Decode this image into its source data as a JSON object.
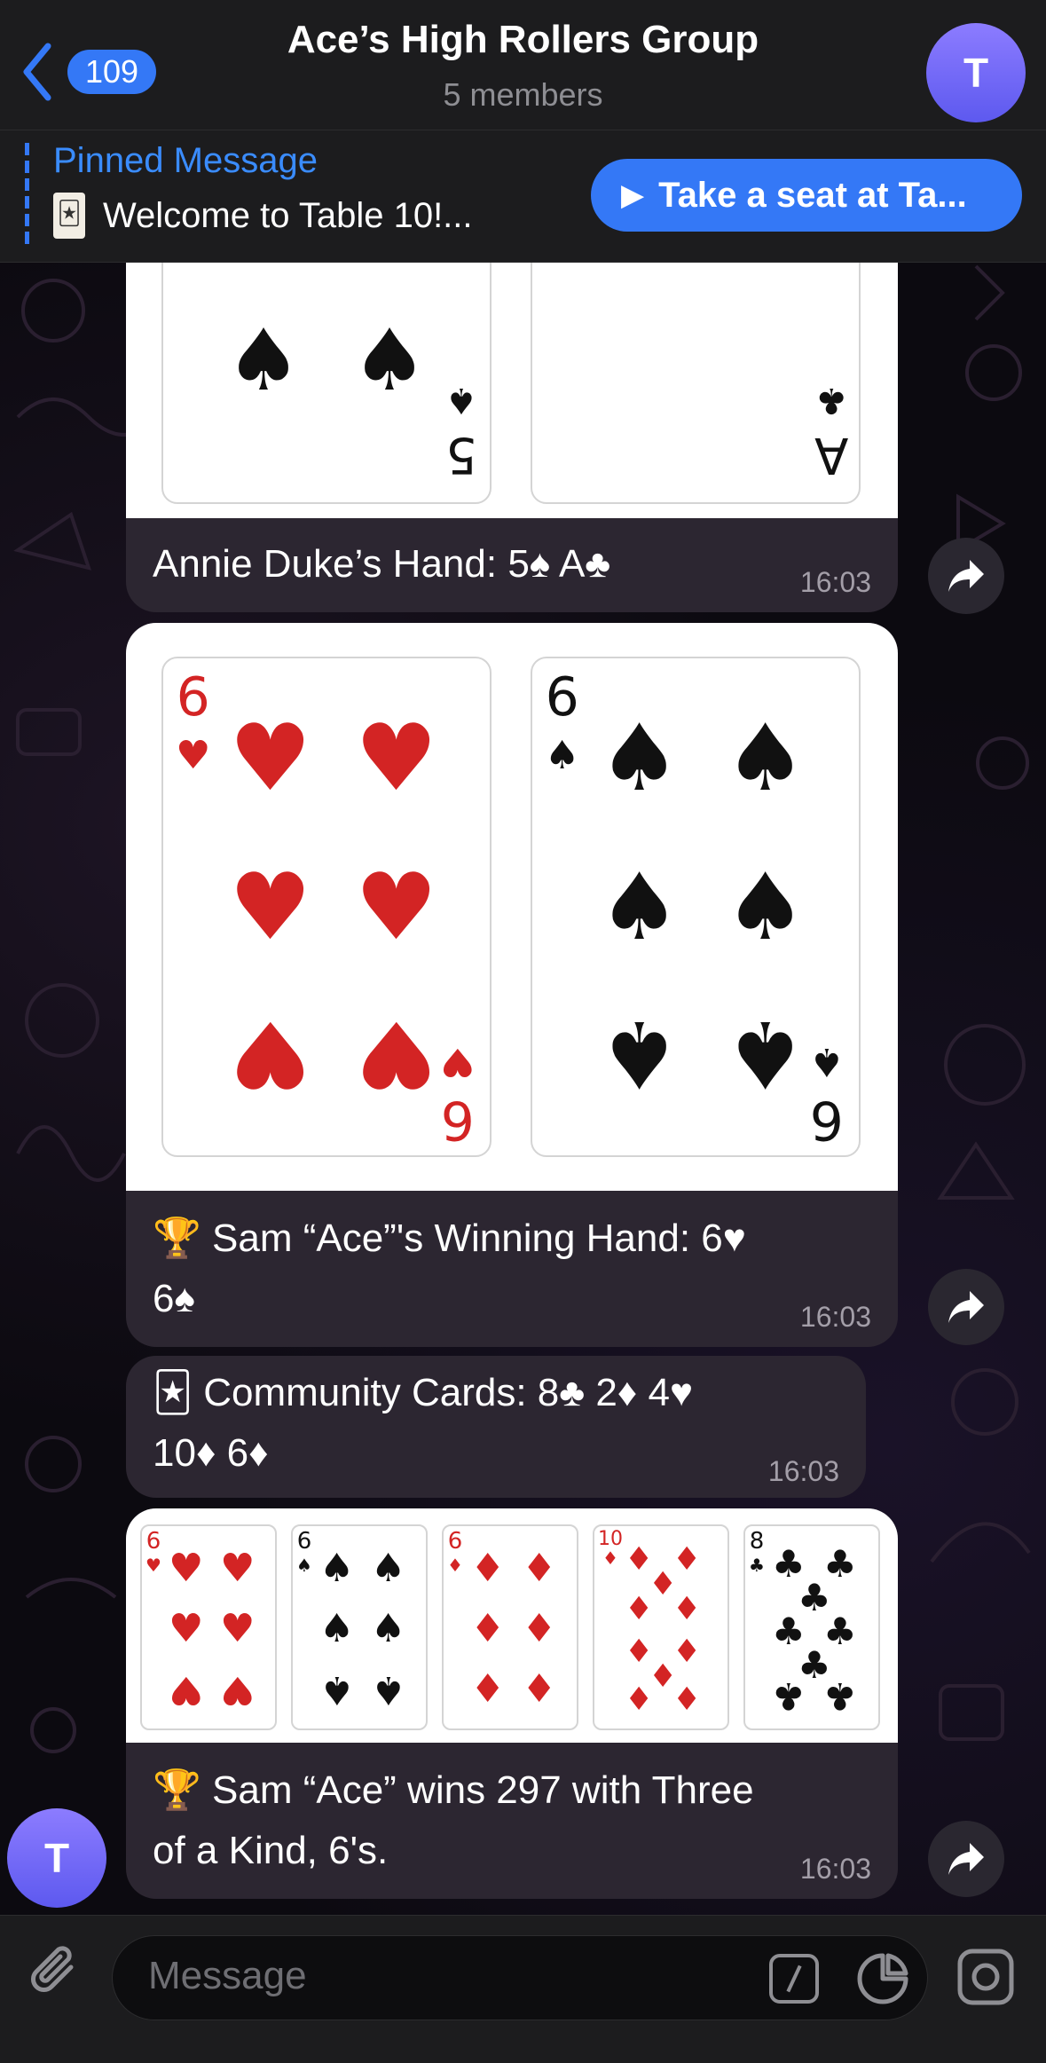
{
  "header": {
    "back_count": "109",
    "title": "Ace’s High Rollers Group",
    "subtitle": "5 members",
    "avatar_letter": "T"
  },
  "pinned": {
    "label": "Pinned Message",
    "text": "Welcome to Table 10!...",
    "button": "Take a seat at Ta..."
  },
  "messages": [
    {
      "caption": "Annie Duke’s Hand: 5♠ A♣",
      "time": "16:03"
    },
    {
      "caption_line1": "🏆 Sam “Ace”'s Winning Hand: 6♥",
      "caption_line2": "6♠",
      "time": "16:03"
    },
    {
      "caption_line1": "🃏 Community Cards: 8♣ 2♦ 4♥",
      "caption_line2": "10♦ 6♦",
      "time": "16:03"
    },
    {
      "caption_line1": "🏆 Sam “Ace” wins 297 with Three",
      "caption_line2": "of a Kind, 6's.",
      "time": "16:03"
    }
  ],
  "cards": {
    "annie": [
      {
        "rank": "5",
        "suit": "♠"
      },
      {
        "rank": "A",
        "suit": "♣"
      }
    ],
    "winning": [
      {
        "rank": "6",
        "suit": "♥"
      },
      {
        "rank": "6",
        "suit": "♠"
      }
    ],
    "board": [
      {
        "rank": "6",
        "suit": "♥"
      },
      {
        "rank": "6",
        "suit": "♠"
      },
      {
        "rank": "6",
        "suit": "♦"
      },
      {
        "rank": "10",
        "suit": "♦"
      },
      {
        "rank": "8",
        "suit": "♣"
      }
    ]
  },
  "input": {
    "placeholder": "Message"
  },
  "footer_avatar_letter": "T",
  "colors": {
    "accent": "#3478f6",
    "bubble": "#2c2631",
    "red_suit": "#d32424"
  }
}
